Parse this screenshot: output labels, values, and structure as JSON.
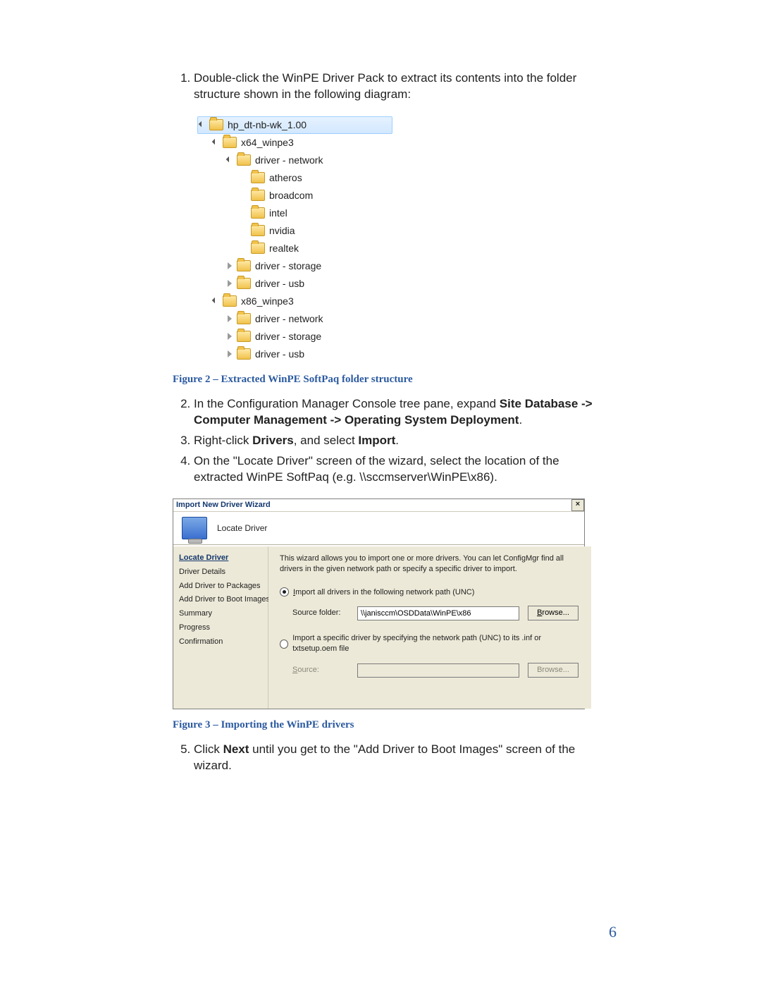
{
  "steps": {
    "s1_pre": "Double-click the WinPE Driver Pack to extract its contents into the folder structure shown in the following diagram:",
    "s2_pre": "In the Configuration Manager Console tree pane, expand ",
    "s2_bold": "Site Database -> Computer Management -> Operating System Deployment",
    "s2_post": ".",
    "s3_pre": "Right-click ",
    "s3_b1": "Drivers",
    "s3_mid": ", and select ",
    "s3_b2": "Import",
    "s3_post": ".",
    "s4": "On the \"Locate Driver\" screen of the wizard, select the location of the extracted WinPE SoftPaq (e.g. \\\\sccmserver\\WinPE\\x86).",
    "s5_pre": "Click ",
    "s5_b": "Next",
    "s5_post": " until you get to the \"Add Driver to Boot Images\" screen of the wizard."
  },
  "captions": {
    "fig2": "Figure 2 – Extracted WinPE SoftPaq folder structure",
    "fig3": "Figure 3 – Importing the WinPE drivers"
  },
  "folder_tree": {
    "items": [
      {
        "depth": 0,
        "toggle": "open",
        "label": "hp_dt-nb-wk_1.00",
        "selected": true
      },
      {
        "depth": 1,
        "toggle": "open",
        "label": "x64_winpe3"
      },
      {
        "depth": 2,
        "toggle": "open",
        "label": "driver - network"
      },
      {
        "depth": 3,
        "toggle": "none",
        "label": "atheros"
      },
      {
        "depth": 3,
        "toggle": "none",
        "label": "broadcom"
      },
      {
        "depth": 3,
        "toggle": "none",
        "label": "intel"
      },
      {
        "depth": 3,
        "toggle": "none",
        "label": "nvidia"
      },
      {
        "depth": 3,
        "toggle": "none",
        "label": "realtek"
      },
      {
        "depth": 2,
        "toggle": "closed",
        "label": "driver - storage"
      },
      {
        "depth": 2,
        "toggle": "closed",
        "label": "driver - usb"
      },
      {
        "depth": 1,
        "toggle": "open",
        "label": "x86_winpe3"
      },
      {
        "depth": 2,
        "toggle": "closed",
        "label": "driver - network"
      },
      {
        "depth": 2,
        "toggle": "closed",
        "label": "driver - storage"
      },
      {
        "depth": 2,
        "toggle": "closed",
        "label": "driver - usb"
      }
    ]
  },
  "wizard": {
    "title": "Import New Driver Wizard",
    "header": "Locate Driver",
    "steps": [
      "Locate Driver",
      "Driver Details",
      "Add Driver to Packages",
      "Add Driver to Boot Images",
      "Summary",
      "Progress",
      "Confirmation"
    ],
    "active_step_index": 0,
    "description": "This wizard allows you to import one or more drivers. You can let ConfigMgr find all drivers in the given network path or specify a specific driver to import.",
    "opt1": {
      "label": "Import all drivers in the following network path (UNC)",
      "checked": true
    },
    "source_folder": {
      "label": "Source folder:",
      "value": "\\\\janisccm\\OSDData\\WinPE\\x86",
      "browse": "Browse..."
    },
    "opt2": {
      "label": "Import a specific driver by specifying the network path (UNC) to its .inf or txtsetup.oem file",
      "checked": false
    },
    "source": {
      "label": "Source:",
      "value": "",
      "browse": "Browse..."
    },
    "close": "×"
  },
  "page_number": "6"
}
